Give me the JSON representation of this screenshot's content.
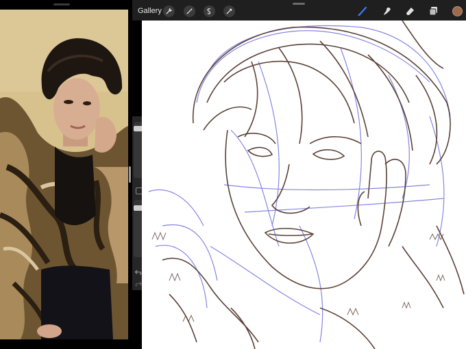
{
  "toolbar": {
    "gallery_label": "Gallery",
    "left_actions": [
      "wrench-icon",
      "magic-wand-icon",
      "selection-icon",
      "transform-arrow-icon"
    ],
    "right_tools": [
      "brush-icon",
      "smudge-icon",
      "eraser-icon",
      "layers-icon"
    ],
    "active_tool": "brush",
    "current_color": "#9a6b4f",
    "brush_active_color": "#3d7bff"
  },
  "sidebar": {
    "brush_size_slider": 0.35,
    "opacity_slider": 0.85,
    "controls": [
      "modify-button",
      "undo-icon",
      "redo-icon"
    ]
  },
  "reference": {
    "description_icon": "reference-photo"
  }
}
